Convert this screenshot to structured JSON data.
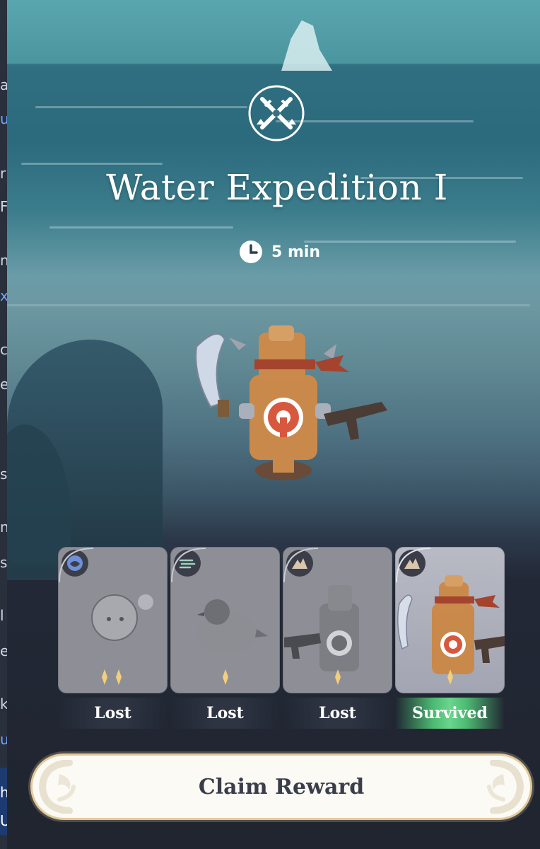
{
  "window": {
    "left_strip_glyphs": [
      "a",
      "u",
      "r",
      "F",
      "n",
      "x",
      "c",
      "e",
      "s",
      "n",
      "s",
      "l",
      "e",
      "k",
      "u",
      "h",
      "U"
    ]
  },
  "expedition": {
    "title": "Water Expedition I",
    "duration": "5 min",
    "icon": "expedition-swords-icon",
    "clock_icon": "clock-icon"
  },
  "team": [
    {
      "element": "water-element-icon",
      "creature": "round-blob-creature",
      "stars": 2,
      "result": "Lost"
    },
    {
      "element": "wind-element-icon",
      "creature": "bird-creature",
      "stars": 1,
      "result": "Lost"
    },
    {
      "element": "earth-element-icon",
      "creature": "target-dummy-creature",
      "stars": 1,
      "result": "Lost"
    },
    {
      "element": "earth-element-icon",
      "creature": "target-dummy-creature",
      "stars": 1,
      "result": "Survived"
    }
  ],
  "actions": {
    "claim_label": "Claim Reward"
  },
  "colors": {
    "survived_green": "#5ccb80",
    "card_grey": "#8e8f96",
    "button_gold": "#e3c99a",
    "button_text": "#3a3d4a"
  }
}
